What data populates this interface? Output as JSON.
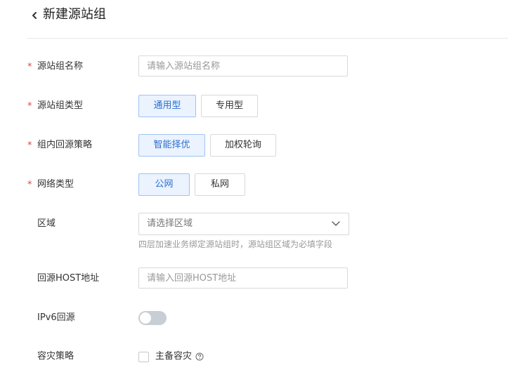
{
  "header": {
    "title": "新建源站组"
  },
  "form": {
    "name": {
      "label": "源站组名称",
      "placeholder": "请输入源站组名称"
    },
    "group_type": {
      "label": "源站组类型",
      "options": [
        "通用型",
        "专用型"
      ],
      "selected": "通用型"
    },
    "strategy": {
      "label": "组内回源策略",
      "options": [
        "智能择优",
        "加权轮询"
      ],
      "selected": "智能择优"
    },
    "network": {
      "label": "网络类型",
      "options": [
        "公网",
        "私网"
      ],
      "selected": "公网"
    },
    "region": {
      "label": "区域",
      "placeholder": "请选择区域",
      "hint": "四层加速业务绑定源站组时，源站组区域为必填字段"
    },
    "host": {
      "label": "回源HOST地址",
      "placeholder": "请输入回源HOST地址"
    },
    "ipv6": {
      "label": "IPv6回源",
      "enabled": false
    },
    "disaster": {
      "label": "容灾策略",
      "checkbox_label": "主备容灾",
      "checked": false
    }
  },
  "required_mark": "*",
  "colors": {
    "accent": "#2c6fd0",
    "accent_bg": "#ebf3ff",
    "required": "#e54545"
  },
  "icons": {
    "back": "chevron-left-icon",
    "select": "chevron-down-icon",
    "help": "question-circle-icon"
  }
}
